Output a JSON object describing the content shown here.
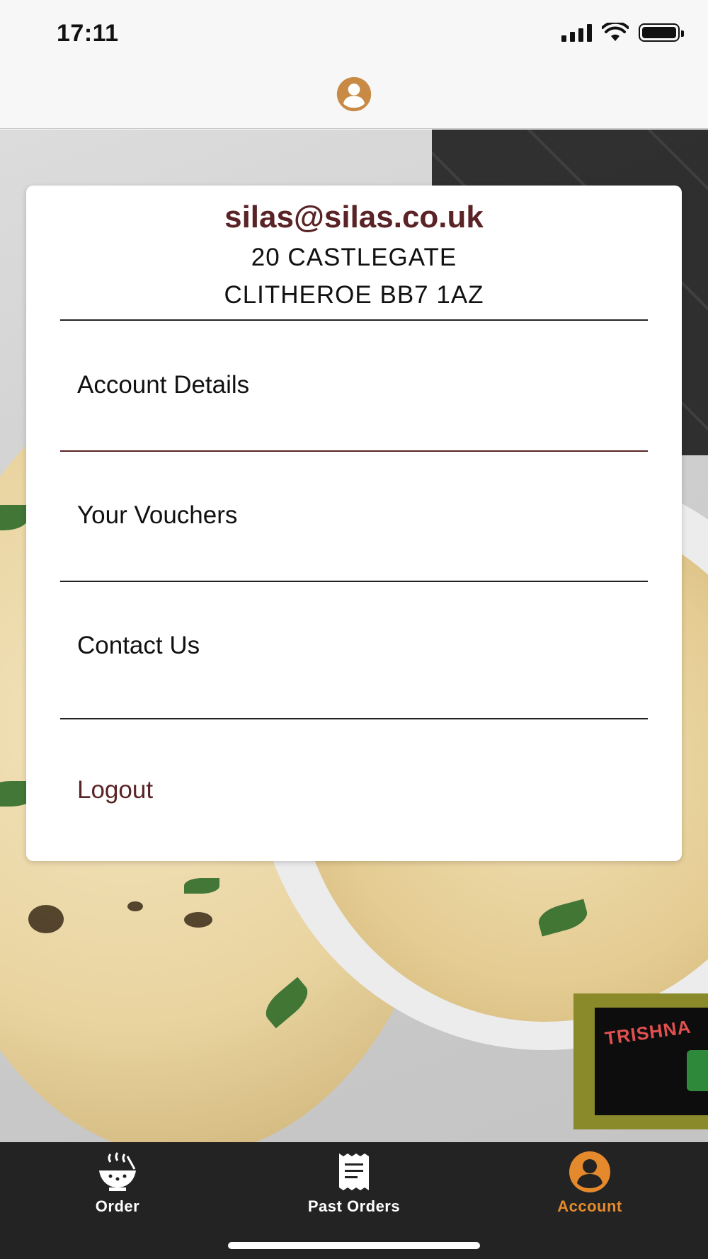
{
  "status_bar": {
    "time": "17:11",
    "icons": [
      "signal-icon",
      "wifi-icon",
      "battery-icon"
    ]
  },
  "header": {
    "icon": "user-avatar-icon",
    "accent_color": "#c98a45"
  },
  "account": {
    "email": "silas@silas.co.uk",
    "address_line1": "20 CASTLEGATE",
    "address_line2": "CLITHEROE BB7 1AZ"
  },
  "menu": {
    "items": [
      {
        "label": "Account Details"
      },
      {
        "label": "Your Vouchers"
      },
      {
        "label": "Contact Us"
      },
      {
        "label": "Logout"
      }
    ]
  },
  "colors": {
    "maroon": "#5a2326",
    "tab_active": "#e48a2c",
    "tab_bar_bg": "#232323"
  },
  "tab_bar": {
    "tabs": [
      {
        "label": "Order",
        "icon": "food-bowl-icon"
      },
      {
        "label": "Past Orders",
        "icon": "receipt-icon"
      },
      {
        "label": "Account",
        "icon": "user-avatar-icon",
        "active": true
      }
    ]
  }
}
